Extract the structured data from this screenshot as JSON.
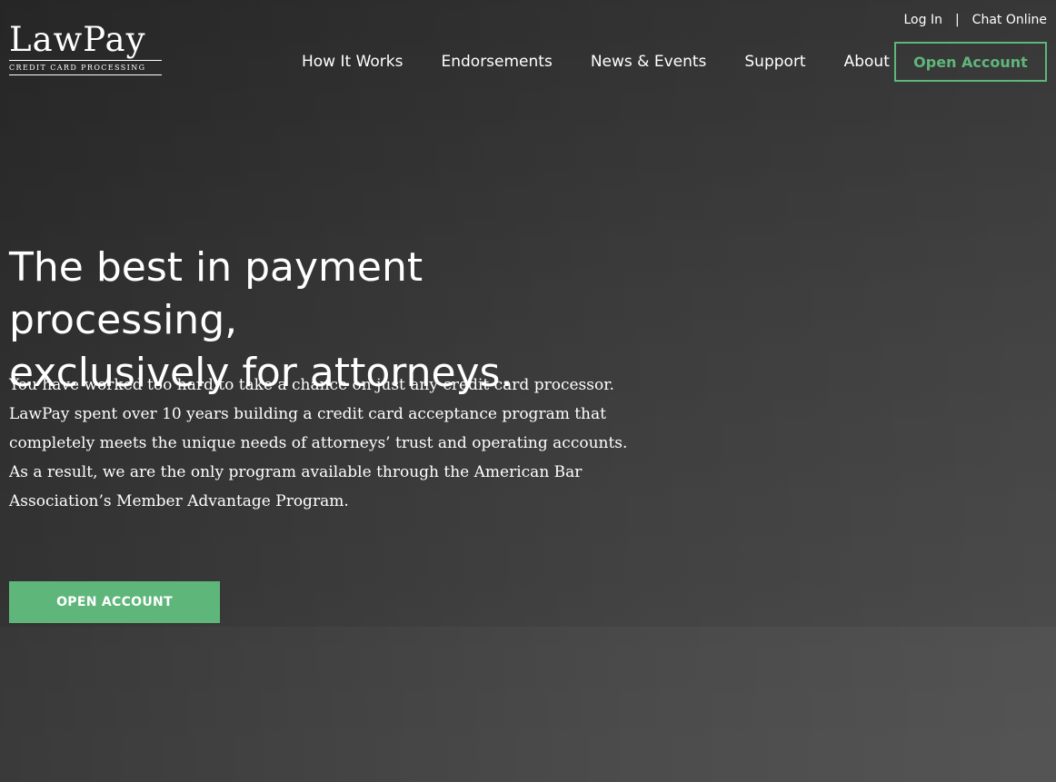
{
  "brand": {
    "name": "LawPay",
    "tagline": "CREDIT CARD PROCESSING"
  },
  "utility_nav": {
    "login": "Log In",
    "separator": "|",
    "chat": "Chat Online"
  },
  "main_nav": {
    "items": [
      "How It Works",
      "Endorsements",
      "News & Events",
      "Support",
      "About"
    ],
    "cta": "Open Account"
  },
  "hero": {
    "headline_line1": "The best in payment processing,",
    "headline_line2": "exclusively for attorneys.",
    "paragraph1": "You have worked too hard to take a chance on just any credit card processor. LawPay spent over 10 years building a credit card acceptance program that completely meets the unique needs of attorneys’ trust and operating accounts.",
    "paragraph2": "As a result, we are the only program available through the American Bar Association’s Member Advantage Program.",
    "cta": "OPEN ACCOUNT"
  },
  "colors": {
    "accent": "#5fb67a"
  }
}
